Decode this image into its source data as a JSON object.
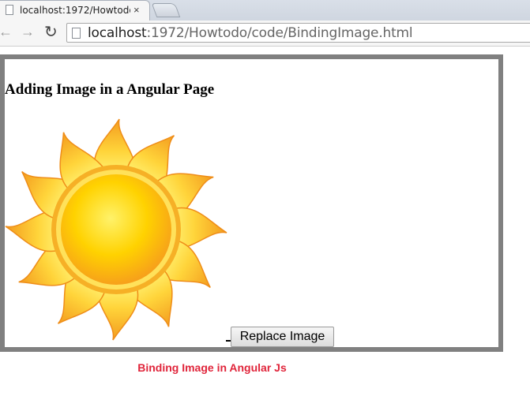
{
  "browser": {
    "tab_title": "localhost:1972/Howtodo/c",
    "tab_close": "×",
    "url_host": "localhost",
    "url_rest": ":1972/Howtodo/code/BindingImage.html"
  },
  "page": {
    "heading": "Adding Image in a Angular Page",
    "button_label": "Replace Image"
  },
  "caption": "Binding Image in Angular Js",
  "colors": {
    "caption": "#e0243a",
    "frame_border": "#808080",
    "sun_core": "#ffd200",
    "sun_ray": "#f5a623"
  },
  "icons": {
    "tab_page": "page-icon",
    "back": "arrow-left-icon",
    "forward": "arrow-right-icon",
    "reload": "reload-icon",
    "omnibox_page": "page-icon"
  }
}
